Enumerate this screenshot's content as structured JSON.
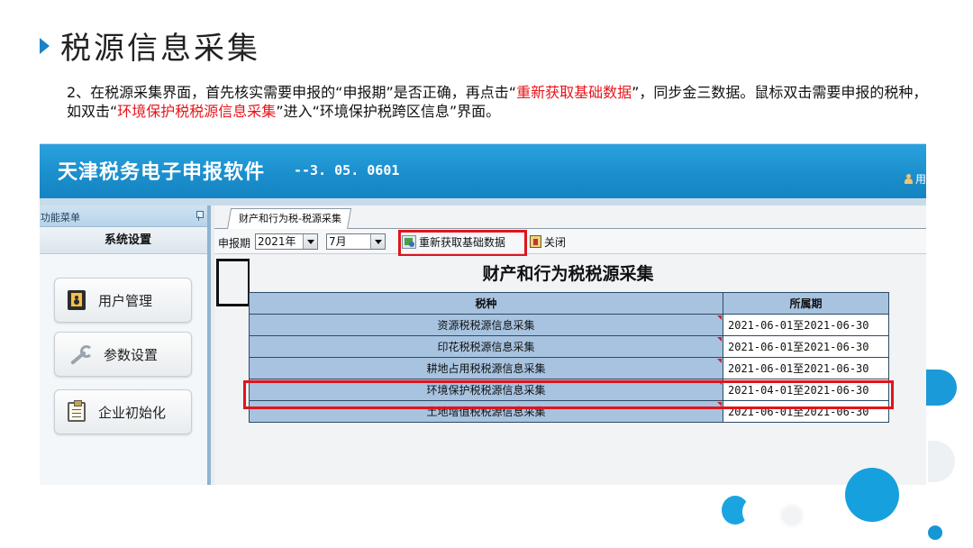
{
  "slide": {
    "title": "税源信息采集",
    "instruction_parts": [
      {
        "text": "2、在税源采集界面，首先核实需要申报的“申报期”是否正确，再点击“",
        "highlight": false
      },
      {
        "text": "重新获取基础数据",
        "highlight": true
      },
      {
        "text": "”，同步金三数据。鼠标双击需要申报的税种，如双击“",
        "highlight": false
      },
      {
        "text": "环境保护税税源信息采集",
        "highlight": true
      },
      {
        "text": "”进入“环境保护税跨区信息”界面。",
        "highlight": false
      }
    ]
  },
  "app": {
    "title": "天津税务电子申报软件",
    "version": "--3. 05. 0601",
    "user_text": "用",
    "sidebar": {
      "header": "功能菜单",
      "section": "系统设置",
      "buttons": [
        {
          "label": "用户管理",
          "icon": "user-management-icon"
        },
        {
          "label": "参数设置",
          "icon": "wrench-icon"
        },
        {
          "label": "企业初始化",
          "icon": "clipboard-icon"
        }
      ]
    },
    "tab": "财产和行为税-税源采集",
    "toolbar": {
      "period_label": "申报期",
      "year": "2021年",
      "month": "7月",
      "refresh_label": "重新获取基础数据",
      "close_label": "关闭"
    },
    "form_title": "财产和行为税税源采集",
    "table": {
      "headers": [
        "税种",
        "所属期"
      ],
      "rows": [
        {
          "name": "资源税税源信息采集",
          "period": "2021-06-01至2021-06-30"
        },
        {
          "name": "印花税税源信息采集",
          "period": "2021-06-01至2021-06-30"
        },
        {
          "name": "耕地占用税税源信息采集",
          "period": "2021-06-01至2021-06-30"
        },
        {
          "name": "环境保护税税源信息采集",
          "period": "2021-04-01至2021-06-30"
        },
        {
          "name": "土地增值税税源信息采集",
          "period": "2021-06-01至2021-06-30"
        }
      ]
    }
  },
  "colors": {
    "accent": "#1a84c7",
    "highlight": "#e8141b",
    "titlebar": "#1b8fcd",
    "table_fill": "#a7c3e0"
  }
}
